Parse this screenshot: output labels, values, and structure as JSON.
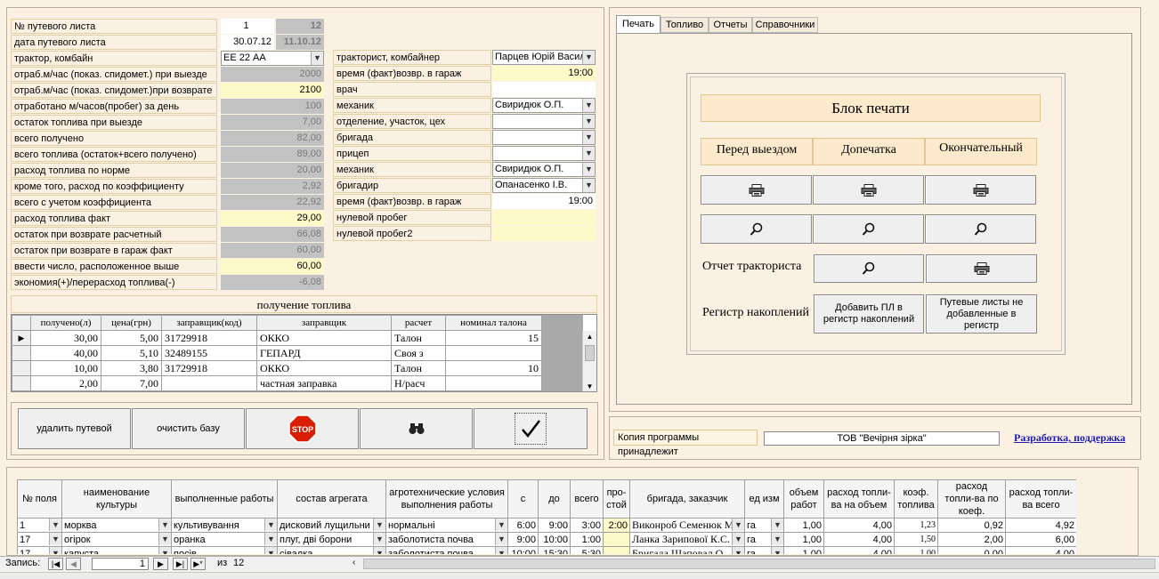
{
  "form": {
    "labels": [
      "№ путевого листа",
      "дата путевого листа",
      "трактор, комбайн",
      "отраб.м/час (показ. спидомет.) при выезде",
      "отраб.м/час (показ. спидомет.)при возврате",
      "отработано м/часов(пробег) за день",
      "остаток топлива при выезде",
      "всего получено",
      "всего топлива (остаток+всего получено)",
      "расход топлива по норме",
      "кроме того, расход по коэффициенту",
      "всего с учетом коэффициента",
      "расход топлива факт",
      "остаток при возврате расчетный",
      "остаток при возврате в гараж  факт",
      "ввести число, расположенное выше",
      "экономия(+)/перерасход топлива(-)"
    ],
    "waybill_no": "1",
    "waybill_no2": "12",
    "waybill_date": "30.07.12",
    "waybill_date2": "11.10.12",
    "tractor": "ЕЕ 22 АА",
    "values": [
      "2000",
      "2100",
      "100",
      "7,00",
      "82,00",
      "89,00",
      "20,00",
      "2,92",
      "22,92",
      "29,00",
      "66,08",
      "60,00",
      "60,00",
      "-6,08"
    ],
    "right_labels": [
      "тракторист, комбайнер",
      "время (факт)возвр. в гараж",
      "врач",
      "механик",
      "отделение, участок, цех",
      "бригада",
      "прицеп",
      "механик",
      "бригадир",
      "время (факт)возвр. в гараж",
      "нулевой пробег",
      "нулевой пробег2"
    ],
    "driver": "Парцев Юрій Васил",
    "return_time": "19:00",
    "mechanic": "Свиридюк О.П.",
    "mechanic2": "Свиридюк О.П.",
    "foreman": "Опанасенко І.В.",
    "return_time2": "19:00"
  },
  "fuel": {
    "title": "получение топлива",
    "headers": [
      "получено(л)",
      "цена(грн)",
      "заправщик(код)",
      "заправщик",
      "расчет",
      "номинал талона"
    ],
    "rows": [
      [
        "30,00",
        "5,00",
        "31729918",
        "ОККО",
        "Талон",
        "15"
      ],
      [
        "40,00",
        "5,10",
        "32489155",
        "ГЕПАРД",
        "Своя з",
        ""
      ],
      [
        "10,00",
        "3,80",
        "31729918",
        "ОККО",
        "Талон",
        "10"
      ],
      [
        "2,00",
        "7,00",
        "",
        "частная заправка",
        "Н/расч",
        ""
      ]
    ]
  },
  "actions": {
    "delete": "удалить путевой",
    "clear": "очистить базу",
    "stop": "STOP"
  },
  "tabs": [
    "Печать",
    "Топливо",
    "Отчеты",
    "Справочники"
  ],
  "print": {
    "title": "Блок печати",
    "cols": [
      "Перед выездом",
      "Допечатка",
      "Окончательный"
    ],
    "driver_report": "Отчет тракториста",
    "registry": "Регистр накоплений",
    "add_btn": "Добавить ПЛ в регистр накоплений",
    "not_added_btn": "Путевые листы не добавленные в регистр"
  },
  "owner": {
    "label": "Копия программы принадлежит",
    "name": "ТОВ \"Вечірня зірка\"",
    "link": "Разработка, поддержка"
  },
  "works": {
    "headers": [
      "№ поля",
      "наименование культуры",
      "выполненные работы",
      "состав агрегата",
      "агротехнические условия выполнения работы",
      "с",
      "до",
      "всего",
      "про-стой",
      "бригада, заказчик",
      "ед изм",
      "объем работ",
      "расход топли-ва на объем",
      "коэф. топлива",
      "расход топли-ва по коеф.",
      "расход топли-ва всего"
    ],
    "rows": [
      [
        "1",
        "морква",
        "культивування",
        "дисковий лущильни",
        "нормальні",
        "6:00",
        "9:00",
        "3:00",
        "2:00",
        "Виконроб Семенюк М",
        "га",
        "1,00",
        "4,00",
        "1,23",
        "0,92",
        "4,92"
      ],
      [
        "17",
        "огірок",
        "оранка",
        "плуг, дві борони",
        "заболотиста почва",
        "9:00",
        "10:00",
        "1:00",
        "",
        "Ланка Зарипової К.С.",
        "га",
        "1,00",
        "4,00",
        "1,50",
        "2,00",
        "6,00"
      ],
      [
        "17",
        "капуста",
        "посів",
        "сівалка",
        "заболотиста почва",
        "10:00",
        "15:30",
        "5:30",
        "",
        "Бригада Шаповал.О.",
        "га",
        "1,00",
        "4,00",
        "1,00",
        "0,00",
        "4,00"
      ]
    ]
  },
  "nav": {
    "label": "Запись:",
    "current": "1",
    "of": "из",
    "total": "12"
  }
}
